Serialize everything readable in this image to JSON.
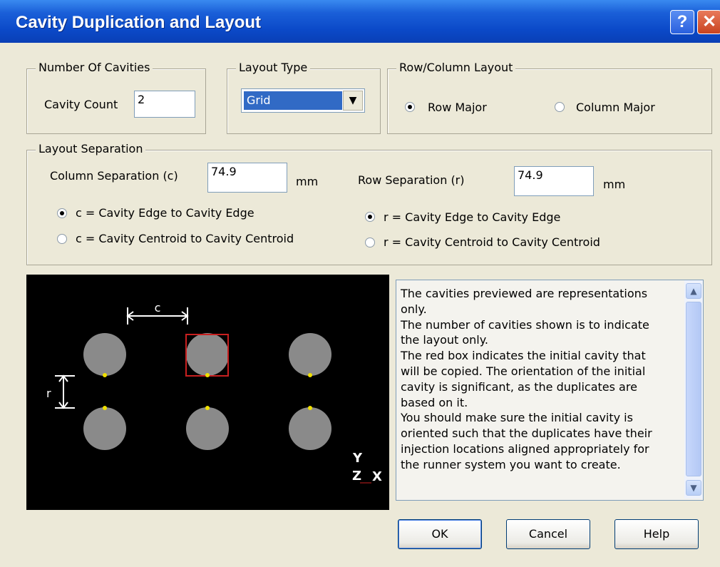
{
  "window": {
    "title": "Cavity Duplication and Layout",
    "help_icon": "help-question-icon",
    "close_icon": "close-x-icon"
  },
  "number_of_cavities": {
    "legend": "Number Of Cavities",
    "cavity_count_label": "Cavity Count",
    "cavity_count_value": "2"
  },
  "layout_type": {
    "legend": "Layout Type",
    "selected": "Grid"
  },
  "row_column_layout": {
    "legend": "Row/Column Layout",
    "options": [
      "Row Major",
      "Column Major"
    ],
    "selected": "Row Major"
  },
  "layout_separation": {
    "legend": "Layout Separation",
    "column_label": "Column Separation (c)",
    "column_value": "74.9",
    "column_unit": "mm",
    "row_label": "Row Separation (r)",
    "row_value": "74.9",
    "row_unit": "mm",
    "column_options": [
      "c = Cavity Edge to Cavity Edge",
      "c = Cavity Centroid to Cavity Centroid"
    ],
    "column_selected": "c = Cavity Edge to Cavity Edge",
    "row_options": [
      "r = Cavity Edge to Cavity Edge",
      "r = Cavity Centroid to Cavity Centroid"
    ],
    "row_selected": "r = Cavity Edge to Cavity Edge"
  },
  "preview": {
    "c_label": "c",
    "r_label": "r",
    "axis_y": "Y",
    "axis_z": "Z",
    "axis_x": "X",
    "highlight_color": "#c82020",
    "cavity_color": "#8a8a8a",
    "gate_color": "#f0e000"
  },
  "info": {
    "lines": [
      "The cavities previewed are representations",
      "only.",
      "The number of cavities shown is to indicate",
      "the layout only.",
      "The red box indicates the initial cavity that",
      "will be copied. The orientation of the initial",
      "cavity is significant, as the duplicates are",
      "based on it.",
      "You should make sure the initial cavity is",
      "oriented such that the duplicates have their",
      "injection locations aligned appropriately for",
      "the runner system you want to create."
    ]
  },
  "buttons": {
    "ok": "OK",
    "cancel": "Cancel",
    "help": "Help"
  }
}
